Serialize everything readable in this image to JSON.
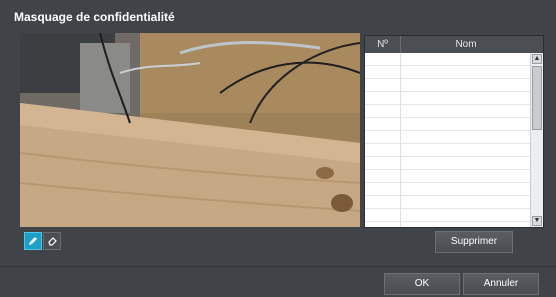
{
  "dialog": {
    "title": "Masquage de confidentialité"
  },
  "list": {
    "columns": {
      "number": "Nº",
      "name": "Nom"
    },
    "rows": []
  },
  "tools": {
    "draw_icon": "pencil-icon",
    "erase_icon": "eraser-icon"
  },
  "buttons": {
    "delete": "Supprimer",
    "ok": "OK",
    "cancel": "Annuler"
  },
  "colors": {
    "accent": "#1e9fc7",
    "background": "#404348"
  }
}
